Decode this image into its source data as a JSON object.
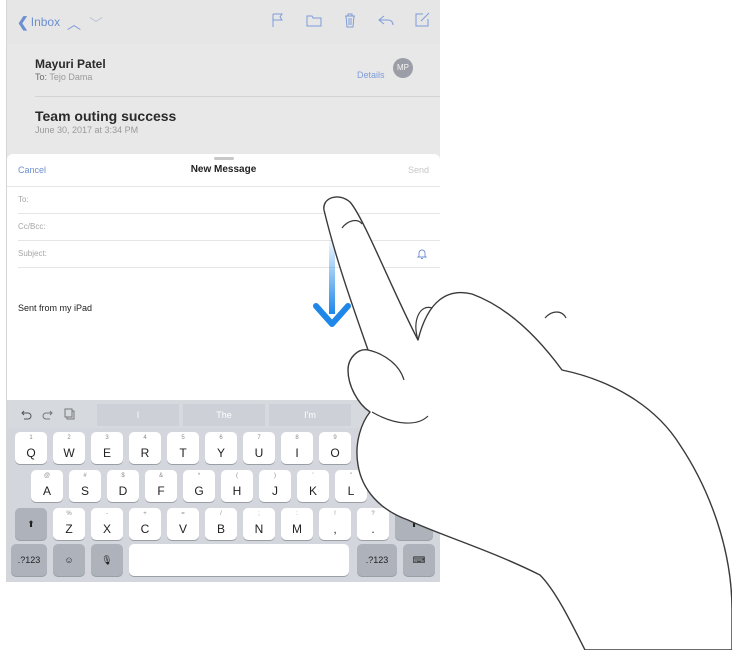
{
  "mail": {
    "nav": {
      "back_label": "Inbox"
    },
    "sender": "Mayuri Patel",
    "to_prefix": "To:",
    "to_name": "Tejo Dama",
    "details_label": "Details",
    "avatar_initials": "MP",
    "subject": "Team outing success",
    "date": "June 30, 2017 at 3:34 PM"
  },
  "compose": {
    "cancel_label": "Cancel",
    "title": "New Message",
    "send_label": "Send",
    "to_label": "To:",
    "ccbcc_label": "Cc/Bcc:",
    "subject_label": "Subject:",
    "body": "Sent from my iPad"
  },
  "keyboard": {
    "suggestions": [
      "I",
      "The",
      "I'm"
    ],
    "rows": [
      [
        {
          "top": "1",
          "main": "Q"
        },
        {
          "top": "2",
          "main": "W"
        },
        {
          "top": "3",
          "main": "E"
        },
        {
          "top": "4",
          "main": "R"
        },
        {
          "top": "5",
          "main": "T"
        },
        {
          "top": "6",
          "main": "Y"
        },
        {
          "top": "7",
          "main": "U"
        },
        {
          "top": "8",
          "main": "I"
        },
        {
          "top": "9",
          "main": "O"
        }
      ],
      [
        {
          "top": "@",
          "main": "A"
        },
        {
          "top": "#",
          "main": "S"
        },
        {
          "top": "$",
          "main": "D"
        },
        {
          "top": "&",
          "main": "F"
        },
        {
          "top": "*",
          "main": "G"
        },
        {
          "top": "(",
          "main": "H"
        },
        {
          "top": ")",
          "main": "J"
        },
        {
          "top": "'",
          "main": "K"
        },
        {
          "top": "\"",
          "main": "L"
        }
      ],
      [
        {
          "top": "%",
          "main": "Z"
        },
        {
          "top": "-",
          "main": "X"
        },
        {
          "top": "+",
          "main": "C"
        },
        {
          "top": "=",
          "main": "V"
        },
        {
          "top": "/",
          "main": "B"
        },
        {
          "top": ";",
          "main": "N"
        },
        {
          "top": ":",
          "main": "M"
        },
        {
          "top": "!",
          "main": ","
        },
        {
          "top": "?",
          "main": "."
        }
      ]
    ],
    "numbers_label": ".?123",
    "emoji_glyph": "☺",
    "mic_glyph": "🎙",
    "keyboard_glyph": "⌨",
    "shift_glyph": "⬆"
  },
  "colors": {
    "accent": "#6b8fd0",
    "arrow": "#1e87e8"
  }
}
